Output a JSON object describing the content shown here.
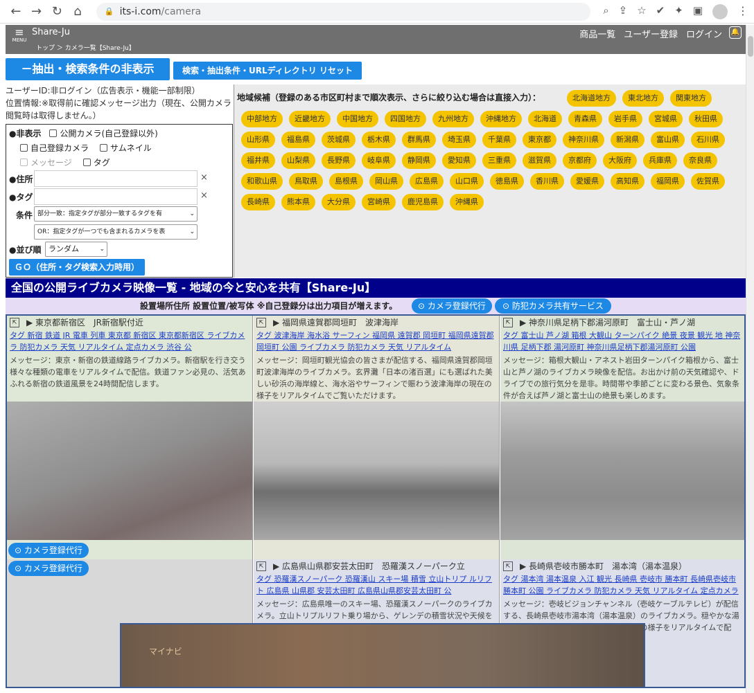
{
  "browser": {
    "url_host": "its-i.com",
    "url_path": "/camera"
  },
  "app": {
    "menu_label": "MENU",
    "brand": "Share-Ju",
    "breadcrumb": "トップ ＞ カメラ一覧【Share-Ju】",
    "links": [
      "商品一覧",
      "ユーザー登録",
      "ログイン"
    ]
  },
  "controls": {
    "hide_conditions": "－抽出・検索条件の非表示",
    "reset": "検索・抽出条件・URLディレクトリ リセット",
    "user_info": "ユーザーID:非ログイン（広告表示・機能一部制限）",
    "location_info": "位置情報:※取得前に確認メッセージ出力（現在、公開カメラ閲覧時は取得しません。）"
  },
  "filter": {
    "hide_label": "●非表示",
    "opt_public": "公開カメラ(自己登録以外)",
    "opt_self": "自己登録カメラ",
    "opt_thumb": "サムネイル",
    "opt_msg": "メッセージ",
    "opt_tag": "タグ",
    "address_label": "●住所",
    "tag_label": "●タグ",
    "cond_label": "条件",
    "cond1": "部分一致：指定タグが部分一致するタグを有",
    "cond2": "OR：指定タグが一つでも含まれるカメラを表",
    "sort_label": "●並び順",
    "sort_value": "ランダム",
    "go": "ＧＯ（住所・タグ検索入力時用）"
  },
  "region": {
    "title": "地域候補（登録のある市区町村まで順次表示、さらに絞り込む場合は直接入力）：",
    "pills": [
      "北海道地方",
      "東北地方",
      "関東地方",
      "中部地方",
      "近畿地方",
      "中国地方",
      "四国地方",
      "九州地方",
      "沖縄地方",
      "北海道",
      "青森県",
      "岩手県",
      "宮城県",
      "秋田県",
      "山形県",
      "福島県",
      "茨城県",
      "栃木県",
      "群馬県",
      "埼玉県",
      "千葉県",
      "東京都",
      "神奈川県",
      "新潟県",
      "富山県",
      "石川県",
      "福井県",
      "山梨県",
      "長野県",
      "岐阜県",
      "静岡県",
      "愛知県",
      "三重県",
      "滋賀県",
      "京都府",
      "大阪府",
      "兵庫県",
      "奈良県",
      "和歌山県",
      "鳥取県",
      "島根県",
      "岡山県",
      "広島県",
      "山口県",
      "徳島県",
      "香川県",
      "愛媛県",
      "高知県",
      "福岡県",
      "佐賀県",
      "長崎県",
      "熊本県",
      "大分県",
      "宮崎県",
      "鹿児島県",
      "沖縄県"
    ]
  },
  "banner": {
    "title": "全国の公開ライブカメラ映像一覧 - 地域の今と安心を共有【Share-Ju】",
    "sub": "設置場所住所 設置位置/被写体 ※自己登録分は出力項目が増えます。",
    "btn_reg": "カメラ登録代行",
    "btn_share": "防犯カメラ共有サービス"
  },
  "cams": [
    {
      "title": "▶ 東京都新宿区　JR新宿駅付近",
      "tags": "タグ 新宿 鉄道 JR 電車 列車 東京都 新宿区 東京都新宿区 ライブカメラ 防犯カメラ 天気 リアルタイム 定点カメラ 渋谷 公",
      "msg": "メッセージ：東京・新宿の鉄道線路ライブカメラ。新宿駅を行き交う様々な種類の電車をリアルタイムで配信。鉄道ファン必見の、活気あふれる新宿の鉄道風景を24時間配信します。"
    },
    {
      "title": "▶ 福岡県遠賀郡岡垣町　波津海岸",
      "tags": "タグ 波津海岸 海水浴 サーフィン 福岡県 遠賀郡 岡垣町 福岡県遠賀郡岡垣町 公園 ライブカメラ 防犯カメラ 天気 リアルタイム",
      "msg": "メッセージ：岡垣町観光協会の皆さまが配信する、福岡県遠賀郡岡垣町波津海岸のライブカメラ。玄界灘「日本の渚百選」にも選ばれた美しい砂浜の海岸線と、海水浴やサーフィンで賑わう波津海岸の現在の様子をリアルタイムでご覧いただけます。"
    },
    {
      "title": "▶ 神奈川県足柄下郡湯河原町　富士山・芦ノ湖",
      "tags": "タグ 富士山 芦ノ湖 箱根 大観山 ターンパイク 絶景 夜景 観光 地 神奈川県 足柄下郡 湯河原町 神奈川県足柄下郡湯河原町 公園",
      "msg": "メッセージ：箱根大観山・アネスト岩田ターンパイク箱根から、富士山と芦ノ湖のライブカメラ映像を配信。お出かけ前の天気確認や、ドライブでの旅行気分を是非。時間帯や季節ごとに変わる景色、気象条件が合えば芦ノ湖と富士山の絶景も楽しめます。"
    },
    {
      "title": "▶ 広島県山県郡安芸太田町　恐羅漢スノーパーク立",
      "tags": "タグ 恐羅漢スノーパーク 恐羅漢山 スキー場 積雪 立山トリプ ルリフト 広島県 山県郡 安芸太田町 広島県山県郡安芸太田町 公",
      "msg": "メッセージ：広島県唯一のスキー場、恐羅漢スノーパークのライブカメラ。立山トリプルリフト乗り場から、ゲレンデの積雪状況や天候をリアルタイムで配信。"
    },
    {
      "title": "▶ 長崎県壱岐市勝本町　湯本湾（湯本温泉）",
      "tags": "タグ 湯本湾 湯本温泉 入江 観光 長崎県 壱岐市 勝本町 長崎県壱岐市勝本町 公園 ライブカメラ 防犯カメラ 天気 リアルタイム 定点カメラ 公",
      "msg": "メッセージ：壱岐ビジョンチャンネル（壱岐ケーブルテレビ）が配信する、長崎県壱岐市湯本湾（湯本温泉）のライブカメラ。穏やかな湯本湾の海と、入江に浮かぶ島影と夕暮れの様子をリアルタイムで配信、ご覧いただけます。また、"
    }
  ],
  "cell_btn": "カメラ登録代行",
  "ad": {
    "text": "マイナビ"
  }
}
